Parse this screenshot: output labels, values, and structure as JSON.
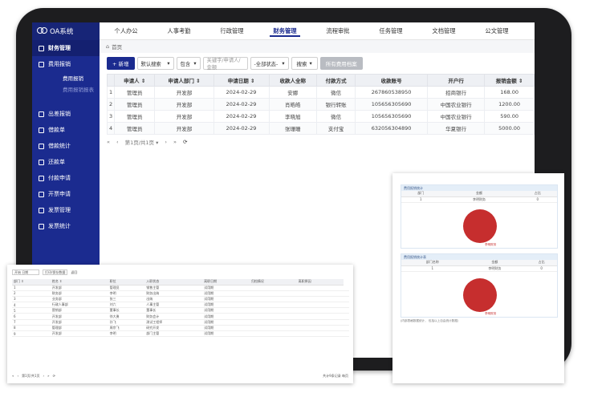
{
  "brand": {
    "title": "OA系统"
  },
  "sidebar": {
    "items": [
      {
        "label": "财务管理",
        "active": true
      },
      {
        "label": "费用报销"
      }
    ],
    "subitems": [
      {
        "label": "费用报销",
        "dim": false
      },
      {
        "label": "费用报销报表",
        "dim": true
      }
    ],
    "more": [
      {
        "label": "出差报销"
      },
      {
        "label": "借款单"
      },
      {
        "label": "借款统计"
      },
      {
        "label": "还款单"
      },
      {
        "label": "付款申请"
      },
      {
        "label": "开票申请"
      },
      {
        "label": "发票管理"
      },
      {
        "label": "发票统计"
      }
    ]
  },
  "topnav": {
    "tabs": [
      {
        "label": "个人办公"
      },
      {
        "label": "人事考勤"
      },
      {
        "label": "行政管理"
      },
      {
        "label": "财务管理",
        "active": true
      },
      {
        "label": "流程审批"
      },
      {
        "label": "任务管理"
      },
      {
        "label": "文档管理"
      },
      {
        "label": "公文管理"
      }
    ]
  },
  "breadcrumb": {
    "label": "首页"
  },
  "toolbar": {
    "add": "+ 新增",
    "sort": "默认搜索",
    "filter": "包含",
    "keyword_placeholder": "关键字/申请人/金额",
    "status": "-全部状态-",
    "search": "搜索",
    "all": "所有费用档案"
  },
  "table": {
    "headers": [
      "",
      "申请人 ⇕",
      "申请人部门 ⇕",
      "申请日期 ⇕",
      "收款人全称",
      "付款方式",
      "收款账号",
      "开户行",
      "报销金额 ⇕"
    ],
    "rows": [
      [
        "1",
        "管理员",
        "开发部",
        "2024-02-29",
        "安娜",
        "微信",
        "267860538950",
        "招商银行",
        "168.00"
      ],
      [
        "2",
        "管理员",
        "开发部",
        "2024-02-29",
        "肖皓皓",
        "银行转账",
        "105656305690",
        "中国农业银行",
        "1200.00"
      ],
      [
        "3",
        "管理员",
        "开发部",
        "2024-02-29",
        "李晓旭",
        "微信",
        "105656305690",
        "中国农业银行",
        "590.00"
      ],
      [
        "4",
        "管理员",
        "开发部",
        "2024-02-29",
        "张珊珊",
        "支付宝",
        "632056304890",
        "华夏银行",
        "5000.00"
      ]
    ]
  },
  "pager": {
    "first": "«",
    "prev": "‹",
    "page": "第1页/共1页 ▾",
    "next": "›",
    "last": "»",
    "refresh": "⟳"
  },
  "doc_left": {
    "input": "开始 日期",
    "btn1": "打印/保存数据",
    "btn2": "返回",
    "headers": [
      "部门 ⇕",
      "姓名 ⇕",
      "职位",
      "入职状态",
      "离职日期",
      "归档情况",
      "离职原因"
    ],
    "rows": [
      [
        "开发部",
        "管理员",
        "销售主管",
        "试用期",
        "",
        "",
        ""
      ],
      [
        "财务部",
        "李明",
        "财务出纳",
        "试用期",
        "",
        "",
        ""
      ],
      [
        "业务部",
        "张三",
        "出纳",
        "试用期",
        "",
        "",
        ""
      ],
      [
        "行政人事部",
        "刘六",
        "人事主管",
        "试用期",
        "",
        "",
        ""
      ],
      [
        "营销部",
        "董事长",
        "董事长",
        "试用期",
        "",
        "",
        ""
      ],
      [
        "开发部",
        "徐大勇",
        "财务会计",
        "试用期",
        "",
        "",
        ""
      ],
      [
        "开发部",
        "孙飞",
        "测试工程师",
        "试用期",
        "",
        "",
        ""
      ],
      [
        "管理部",
        "周宗飞",
        "研究开发",
        "试用期",
        "",
        "",
        ""
      ],
      [
        "开发部",
        "李明",
        "部门主管",
        "试用期",
        "",
        "",
        ""
      ]
    ],
    "pager": "第1页/共1页",
    "pager_right": "共计9条记录  每页"
  },
  "doc_right": {
    "panel1": {
      "title": "费用报销统计",
      "headers": [
        "部门",
        "金额",
        "占比"
      ],
      "row": [
        "1",
        "李明财务",
        "0"
      ]
    },
    "panel2": {
      "title": "费用报销统计表",
      "headers": [
        "部门名称",
        "金额",
        "占比"
      ],
      "row": [
        "1",
        "李明财务",
        "0"
      ]
    },
    "pie_label": "李明财务",
    "footer": "(内部表格数据统计， 包括以上自由统计数据)"
  }
}
